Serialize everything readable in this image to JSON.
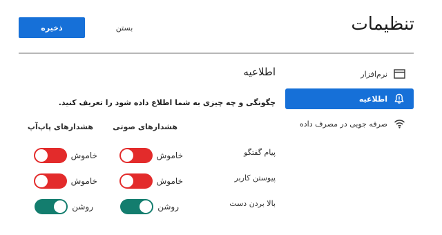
{
  "header": {
    "title": "تنظیمات",
    "save_label": "ذخیره",
    "close_label": "بستن"
  },
  "sidebar": {
    "items": [
      {
        "label": "نرم‌افزار",
        "icon": "window-icon",
        "active": false
      },
      {
        "label": "اطلاعیه",
        "icon": "bell-icon",
        "active": true
      },
      {
        "label": "صرفه جویی در مصرف داده",
        "icon": "wifi-icon",
        "active": false
      }
    ]
  },
  "main": {
    "title": "اطلاعیه",
    "description": "چگونگی و چه چیزی به شما اطلاع داده شود را تعریف کنید.",
    "columns": {
      "sound": "هشدارهای صوتی",
      "popup": "هشدارهای پاپ‌آپ"
    },
    "rows": [
      {
        "label": "پیام گفتگو",
        "sound": {
          "state": "off",
          "text": "خاموش"
        },
        "popup": {
          "state": "off",
          "text": "خاموش"
        }
      },
      {
        "label": "پیوستن کاربر",
        "sound": {
          "state": "off",
          "text": "خاموش"
        },
        "popup": {
          "state": "off",
          "text": "خاموش"
        }
      },
      {
        "label": "بالا بردن دست",
        "sound": {
          "state": "on",
          "text": "روشن"
        },
        "popup": {
          "state": "on",
          "text": "روشن"
        }
      }
    ]
  },
  "colors": {
    "accent": "#1670d8",
    "toggle_off": "#e32b2b",
    "toggle_on": "#137d6e",
    "divider": "#b7b7b7"
  }
}
